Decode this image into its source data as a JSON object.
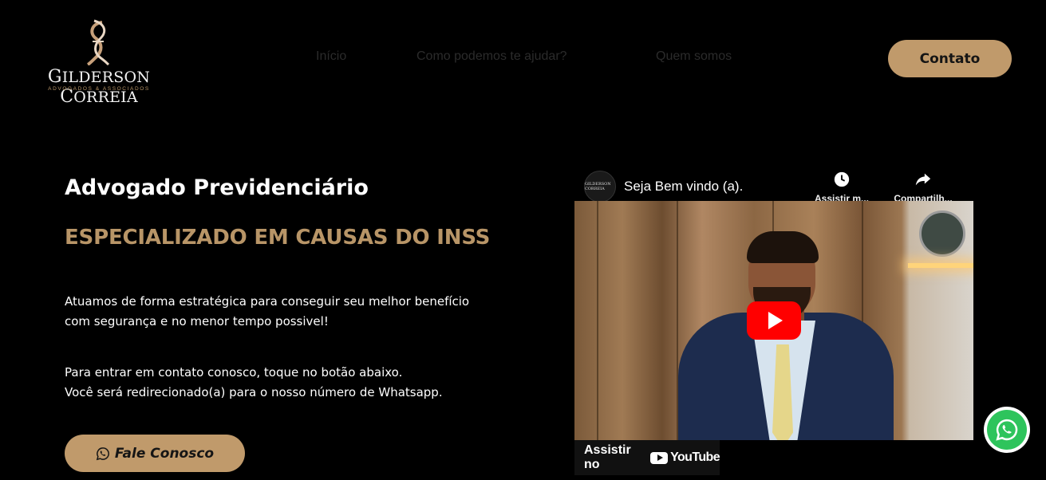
{
  "brand": {
    "name_first_big": "G",
    "name_first_rest": "ILDERSON",
    "name_last_big": "C",
    "name_last_rest": "ORREIA",
    "tagline": "ADVOGADOS & ASSOCIADOS",
    "mark": "G"
  },
  "nav": {
    "items": [
      {
        "label": "Início"
      },
      {
        "label": "Como podemos te ajudar?"
      },
      {
        "label": "Quem somos"
      }
    ],
    "contact_label": "Contato"
  },
  "hero": {
    "title": "Advogado Previdenciário",
    "subtitle": "ESPECIALIZADO EM CAUSAS DO INSS",
    "paragraph1_line1": "Atuamos de forma estratégica para conseguir seu melhor benefício",
    "paragraph1_line2": "com segurança e no menor tempo possivel!",
    "paragraph2_line1": "Para entrar em contato conosco, toque no botão abaixo.",
    "paragraph2_line2": "Você será redirecionado(a) para o nosso número de Whatsapp.",
    "cta_label": "Fale Conosco",
    "cta_icon": "whatsapp-icon"
  },
  "video": {
    "title": "Seja Bem vindo (a).",
    "watch_later_label": "Assistir m...",
    "share_label": "Compartilh...",
    "watch_on_label": "Assistir no",
    "youtube_label": "YouTube",
    "channel_avatar_text": "GILDERSON CORREIA",
    "play_icon": "play-icon"
  },
  "colors": {
    "background": "#000000",
    "accent": "#c09a6b",
    "accent_text": "#b89567",
    "whatsapp": "#2ec45c",
    "youtube_red": "#ff0000"
  }
}
